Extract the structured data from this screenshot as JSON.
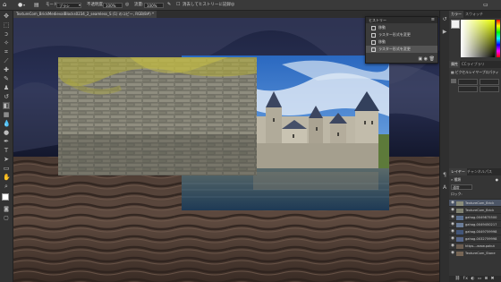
{
  "options_bar": {
    "mode_label": "モード:",
    "mode_value": "ブラシ",
    "opacity_label": "不透明度:",
    "opacity_value": "100%",
    "flow_label": "流量:",
    "flow_value": "100%",
    "erase_history_label": "消去してヒストリーに記録"
  },
  "tabs": {
    "doc_tab": "TextureCom_BrickMedievalBlocks0234_2_seamless_S (1) のコピー, RGB/8#) *"
  },
  "history": {
    "title": "ヒストリー",
    "items": [
      {
        "label": "移動",
        "selected": false
      },
      {
        "label": "ラスター形式を変更",
        "selected": false
      },
      {
        "label": "移動",
        "selected": false
      },
      {
        "label": "ラスター形式を変更",
        "selected": true
      }
    ]
  },
  "swatches": {
    "tab1": "カラー",
    "tab2": "スウォッチ"
  },
  "properties": {
    "tab1": "属性",
    "tab2": "CCライブラリ",
    "layer_type": "ピクセルレイヤープロパティ"
  },
  "layers": {
    "tab1": "レイヤー",
    "tab2": "チャンネル",
    "tab3": "パス",
    "filter_label": "種類",
    "blend_mode": "通常",
    "lock_label": "ロック:",
    "items": [
      {
        "name": "TextureCom_Brick",
        "color": "#8a8c7a",
        "selected": true
      },
      {
        "name": "TextureCom_Brick",
        "color": "#7f806f",
        "selected": false
      },
      {
        "name": "gahag-0049875500",
        "color": "#5a6f8e",
        "selected": false
      },
      {
        "name": "gahag-0049450217",
        "color": "#6b7d98",
        "selected": false
      },
      {
        "name": "gahag-0049759998",
        "color": "#43567a",
        "selected": false
      },
      {
        "name": "gahag-0032759998",
        "color": "#566689",
        "selected": false
      },
      {
        "name": "https---www.pakut",
        "color": "#6a5c50",
        "selected": false
      },
      {
        "name": "TextureCom_Stone",
        "color": "#776655",
        "selected": false
      }
    ]
  },
  "icons": {
    "tools": [
      "move-icon",
      "marquee-icon",
      "lasso-icon",
      "quick-select-icon",
      "crop-icon",
      "eyedropper-icon",
      "healing-icon",
      "brush-icon",
      "stamp-icon",
      "history-brush-icon",
      "eraser-icon",
      "gradient-icon",
      "blur-icon",
      "dodge-icon",
      "pen-icon",
      "type-icon",
      "path-select-icon",
      "rectangle-icon",
      "hand-icon",
      "zoom-icon"
    ]
  }
}
